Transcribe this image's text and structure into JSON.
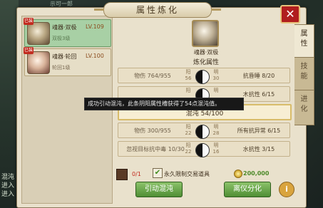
{
  "background": {
    "left_text": [
      "混沌",
      "进入",
      "进入"
    ],
    "top_text": "示可一郎"
  },
  "panel": {
    "title": "属性炼化",
    "close": "✕"
  },
  "items": [
    {
      "name": "魂器·双极",
      "level": "LV.109",
      "sub": "双极3级",
      "badge": "已装",
      "selected": true
    },
    {
      "name": "魂器·轮回",
      "level": "LV.100",
      "sub": "轮回1级",
      "badge": "已装",
      "selected": false
    }
  ],
  "selected": {
    "name": "魂器·双极",
    "section_title": "炼化属性"
  },
  "rows": [
    {
      "left": "物伤 764/955",
      "yang": "阳",
      "yin_val": "56",
      "yin": "明",
      "yang_val": "30",
      "right": "抗昏睡 8/20"
    },
    {
      "left": "",
      "yang": "阳",
      "yin_val": "",
      "yin": "明",
      "yang_val": "",
      "right": "木抗性 6/15"
    },
    {
      "center": "混沌 54/100"
    },
    {
      "left": "物伤 300/955",
      "yang": "阳",
      "yin_val": "22",
      "yin": "明",
      "yang_val": "28",
      "right": "所有抗异常 6/15"
    },
    {
      "left": "忽视目标抗中毒 10/30",
      "yang": "阳",
      "yin_val": "22",
      "yin": "明",
      "yang_val": "16",
      "right": "水抗性 3/15"
    }
  ],
  "tooltip": "成功引动混沌，此条阴阳属性槽获得了54点混沌值。",
  "bottom": {
    "material_count": "0/1",
    "bind_label": "永久限制交易道具",
    "check": "✔",
    "coin_amount": "200,000"
  },
  "buttons": {
    "primary": "引动混沌",
    "secondary": "离仪分化",
    "info": "i"
  },
  "tabs": [
    {
      "label": "属性",
      "active": true
    },
    {
      "label": "技能",
      "active": false
    },
    {
      "label": "进化",
      "active": false
    }
  ]
}
